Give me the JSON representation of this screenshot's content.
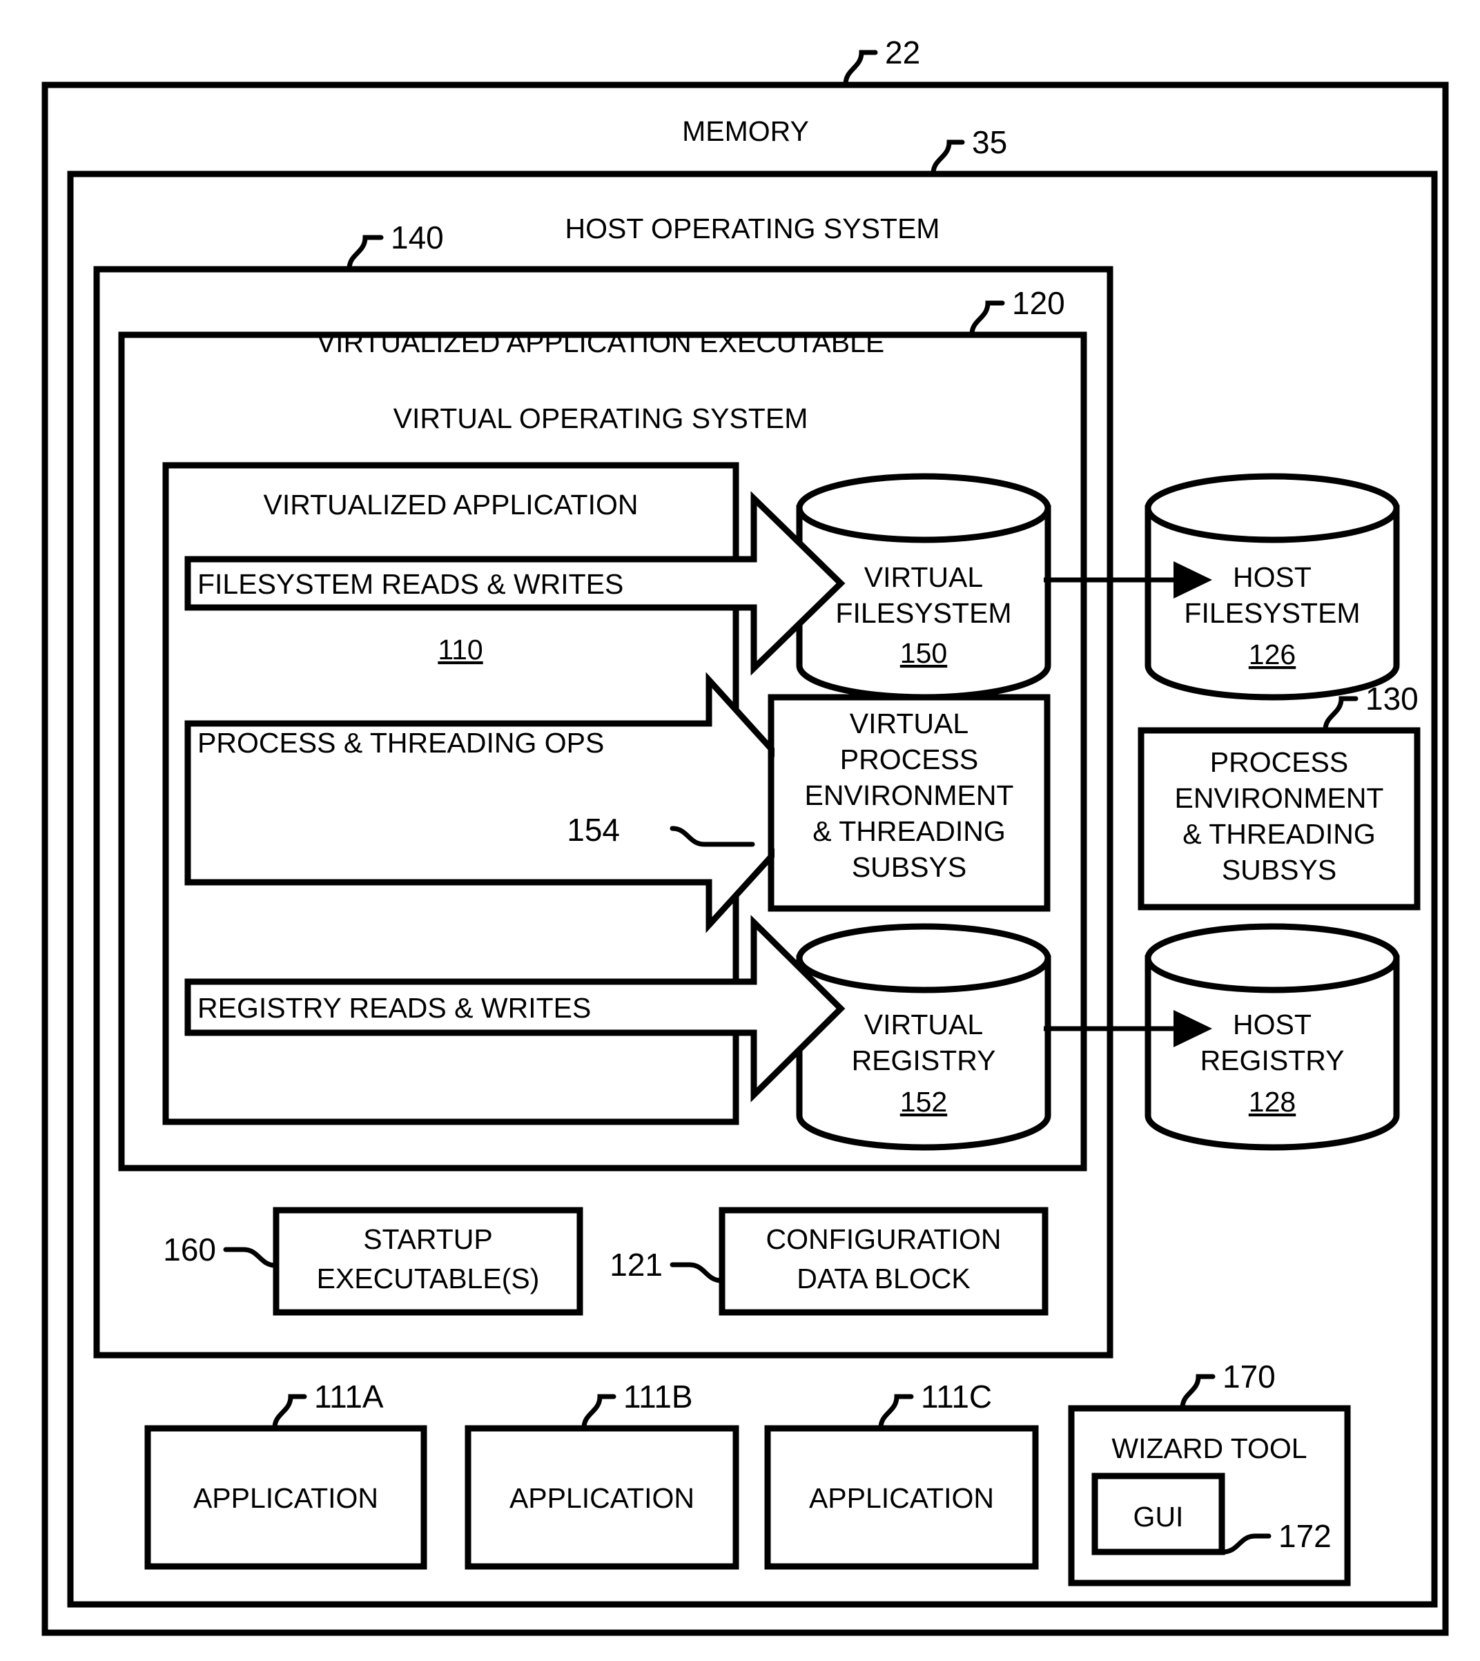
{
  "figure": {
    "type": "patent-block-diagram",
    "background": "#ffffff",
    "stroke": "#000000"
  },
  "frames": {
    "memory": {
      "label": "MEMORY",
      "ref": "22"
    },
    "host_os": {
      "label": "HOST OPERATING SYSTEM",
      "ref": "35"
    },
    "virtualized_application_executable": {
      "label": "VIRTUALIZED APPLICATION EXECUTABLE",
      "ref": "140"
    },
    "virtual_operating_system": {
      "label": "VIRTUAL OPERATING SYSTEM",
      "ref": "120"
    },
    "virtualized_application": {
      "label": "VIRTUALIZED APPLICATION",
      "ref": "110"
    }
  },
  "arrows": [
    {
      "label": "FILESYSTEM READS & WRITES",
      "ref": ""
    },
    {
      "label": "PROCESS & THREADING OPS",
      "ref": "154"
    },
    {
      "label": "REGISTRY READS & WRITES",
      "ref": ""
    }
  ],
  "cylinders": [
    {
      "line1": "VIRTUAL",
      "line2": "FILESYSTEM",
      "ref": "150"
    },
    {
      "line1": "HOST",
      "line2": "FILESYSTEM",
      "ref": "126"
    },
    {
      "line1": "VIRTUAL",
      "line2": "REGISTRY",
      "ref": "152"
    },
    {
      "line1": "HOST",
      "line2": "REGISTRY",
      "ref": "128"
    }
  ],
  "boxes": {
    "virtual_process_subsys": {
      "lines": [
        "VIRTUAL",
        "PROCESS",
        "ENVIRONMENT",
        "& THREADING",
        "SUBSYS"
      ],
      "ref": "154"
    },
    "host_process_subsys": {
      "lines": [
        "PROCESS",
        "ENVIRONMENT",
        "& THREADING",
        "SUBSYS"
      ],
      "ref": "130"
    },
    "startup_executables": {
      "lines": [
        "STARTUP",
        "EXECUTABLE(S)"
      ],
      "ref": "160"
    },
    "configuration_data_block": {
      "lines": [
        "CONFIGURATION",
        "DATA BLOCK"
      ],
      "ref": "121"
    },
    "wizard_tool": {
      "label": "WIZARD TOOL",
      "ref": "170",
      "gui": {
        "label": "GUI",
        "ref": "172"
      }
    }
  },
  "applications": [
    {
      "label": "APPLICATION",
      "ref": "111A"
    },
    {
      "label": "APPLICATION",
      "ref": "111B"
    },
    {
      "label": "APPLICATION",
      "ref": "111C"
    }
  ]
}
